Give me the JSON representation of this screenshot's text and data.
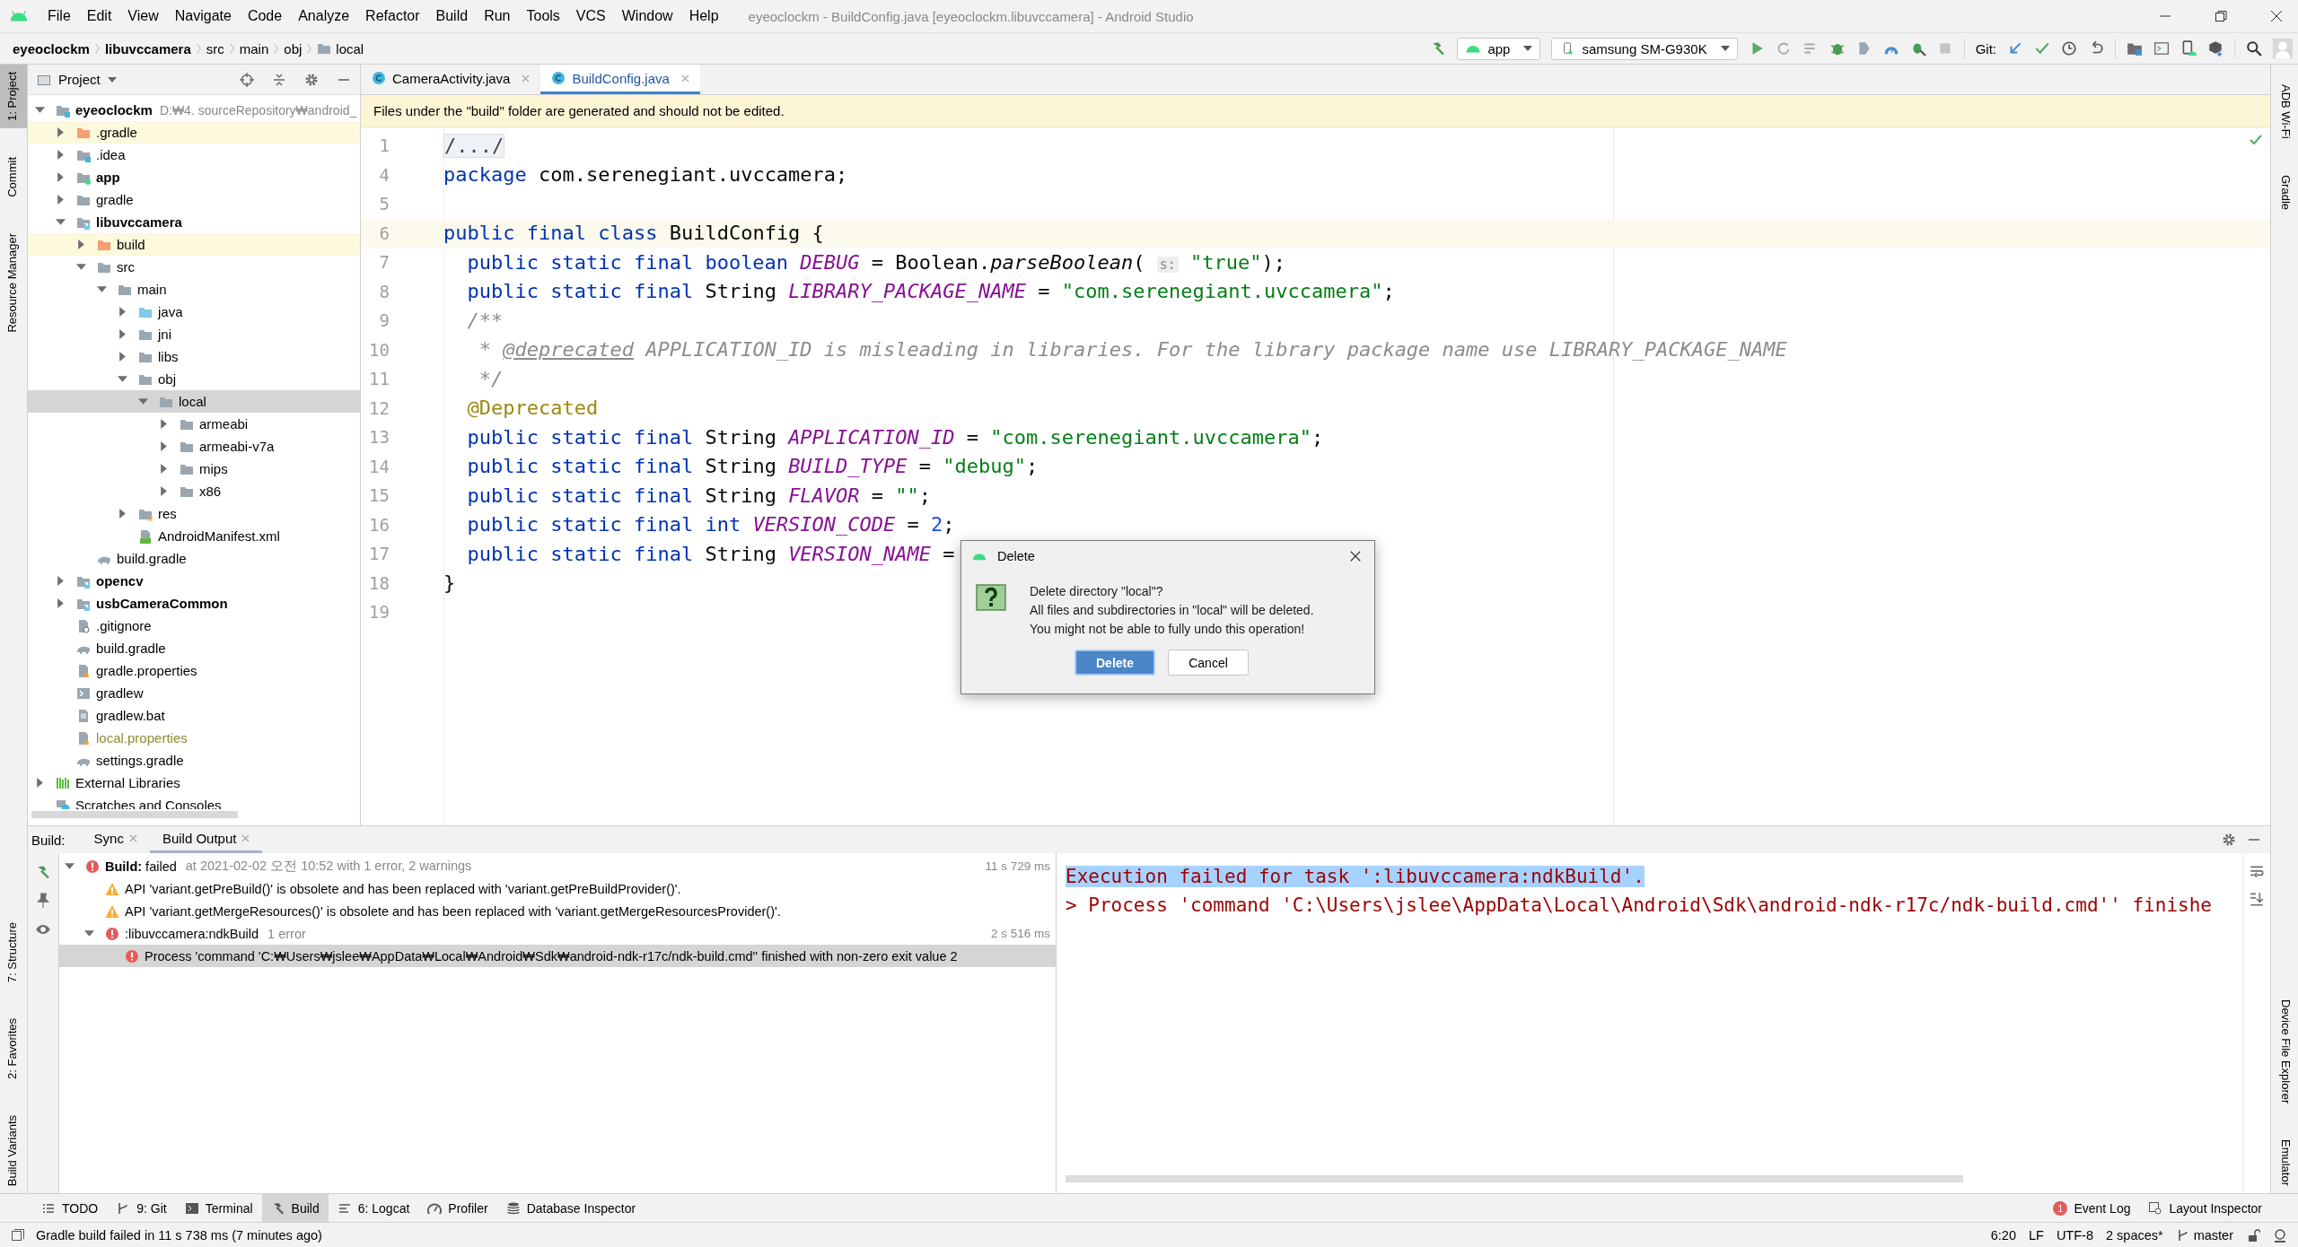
{
  "window": {
    "title": "eyeoclockm - BuildConfig.java [eyeoclockm.libuvccamera] - Android Studio"
  },
  "menu": [
    "File",
    "Edit",
    "View",
    "Navigate",
    "Code",
    "Analyze",
    "Refactor",
    "Build",
    "Run",
    "Tools",
    "VCS",
    "Window",
    "Help"
  ],
  "breadcrumbs": [
    {
      "label": "eyeoclockm",
      "bold": true
    },
    {
      "label": "libuvccamera",
      "bold": true
    },
    {
      "label": "src",
      "bold": false
    },
    {
      "label": "main",
      "bold": false
    },
    {
      "label": "obj",
      "bold": false
    },
    {
      "label": "local",
      "bold": false
    }
  ],
  "toolbar": {
    "run_config": "app",
    "device": "samsung SM-G930K",
    "git_label": "Git:"
  },
  "left_stripe": [
    {
      "label": "1: Project",
      "selected": true
    },
    {
      "label": "Commit",
      "selected": false
    },
    {
      "label": "Resource Manager",
      "selected": false
    }
  ],
  "left_stripe_bottom": [
    "7: Structure",
    "2: Favorites",
    "Build Variants"
  ],
  "right_stripe": [
    "ADB Wi-Fi",
    "Gradle"
  ],
  "right_stripe_bottom": [
    "Device File Explorer",
    "Emulator"
  ],
  "project": {
    "view": "Project",
    "tree": [
      {
        "label": "eyeoclockm",
        "hint": "D:₩4. sourceRepository₩android_",
        "kind": "module",
        "bold": true,
        "selected": false,
        "expanded": true,
        "children": [
          {
            "label": ".gradle",
            "kind": "folder-excluded",
            "excluded": true,
            "selected": false,
            "expanded": false
          },
          {
            "label": ".idea",
            "kind": "folder-config",
            "selected": false,
            "expanded": false
          },
          {
            "label": "app",
            "kind": "module-app",
            "bold": true,
            "selected": false,
            "expanded": false
          },
          {
            "label": "gradle",
            "kind": "folder",
            "selected": false,
            "expanded": false
          },
          {
            "label": "libuvccamera",
            "kind": "module-lib",
            "bold": true,
            "selected": false,
            "expanded": true,
            "children": [
              {
                "label": "build",
                "kind": "folder-excluded",
                "excluded": true,
                "selected": false,
                "expanded": false
              },
              {
                "label": "src",
                "kind": "folder",
                "selected": false,
                "expanded": true,
                "children": [
                  {
                    "label": "main",
                    "kind": "folder",
                    "selected": false,
                    "expanded": true,
                    "children": [
                      {
                        "label": "java",
                        "kind": "folder-source",
                        "selected": false,
                        "expanded": false
                      },
                      {
                        "label": "jni",
                        "kind": "folder",
                        "selected": false,
                        "expanded": false
                      },
                      {
                        "label": "libs",
                        "kind": "folder",
                        "selected": false,
                        "expanded": false
                      },
                      {
                        "label": "obj",
                        "kind": "folder",
                        "selected": false,
                        "expanded": true,
                        "children": [
                          {
                            "label": "local",
                            "kind": "folder",
                            "selected": true,
                            "expanded": true,
                            "children": [
                              {
                                "label": "armeabi",
                                "kind": "folder",
                                "selected": false,
                                "expanded": false
                              },
                              {
                                "label": "armeabi-v7a",
                                "kind": "folder",
                                "selected": false,
                                "expanded": false
                              },
                              {
                                "label": "mips",
                                "kind": "folder",
                                "selected": false,
                                "expanded": false
                              },
                              {
                                "label": "x86",
                                "kind": "folder",
                                "selected": false,
                                "expanded": false
                              }
                            ]
                          }
                        ]
                      },
                      {
                        "label": "res",
                        "kind": "folder-res",
                        "selected": false,
                        "expanded": false
                      },
                      {
                        "label": "AndroidManifest.xml",
                        "kind": "manifest",
                        "selected": false
                      }
                    ]
                  }
                ]
              },
              {
                "label": "build.gradle",
                "kind": "gradle",
                "selected": false
              }
            ]
          },
          {
            "label": "opencv",
            "kind": "module-lib",
            "bold": true,
            "selected": false,
            "expanded": false
          },
          {
            "label": "usbCameraCommon",
            "kind": "module-lib",
            "bold": true,
            "selected": false,
            "expanded": false
          },
          {
            "label": ".gitignore",
            "kind": "gitignore",
            "selected": false
          },
          {
            "label": "build.gradle",
            "kind": "gradle",
            "selected": false
          },
          {
            "label": "gradle.properties",
            "kind": "properties",
            "selected": false
          },
          {
            "label": "gradlew",
            "kind": "gradlew",
            "selected": false
          },
          {
            "label": "gradlew.bat",
            "kind": "bat",
            "selected": false
          },
          {
            "label": "local.properties",
            "kind": "properties",
            "ignored": true,
            "selected": false
          },
          {
            "label": "settings.gradle",
            "kind": "gradle",
            "selected": false
          }
        ]
      },
      {
        "label": "External Libraries",
        "kind": "libraries",
        "selected": false,
        "expanded": false
      },
      {
        "label": "Scratches and Consoles",
        "kind": "scratches",
        "selected": false
      }
    ]
  },
  "editor": {
    "tabs": [
      {
        "label": "CameraActivity.java",
        "selected": false
      },
      {
        "label": "BuildConfig.java",
        "selected": true
      }
    ],
    "banner": "Files under the \"build\" folder are generated and should not be edited.",
    "lines": [
      {
        "number": "1",
        "current": false,
        "tokens": [
          {
            "kind": "fold",
            "text": "/.../"
          }
        ]
      },
      {
        "number": "4",
        "current": false,
        "tokens": [
          {
            "kind": "kw",
            "text": "package "
          },
          {
            "kind": "plain",
            "text": "com.serenegiant.uvccamera;"
          }
        ]
      },
      {
        "number": "5",
        "current": false
      },
      {
        "number": "6",
        "current": true,
        "tokens": [
          {
            "kind": "kw",
            "text": "public final class "
          },
          {
            "kind": "plain",
            "text": "BuildConfig {"
          }
        ]
      },
      {
        "number": "7",
        "current": false,
        "tokens": [
          {
            "kind": "kw",
            "text": "  public static final boolean "
          },
          {
            "kind": "field",
            "text": "DEBUG"
          },
          {
            "kind": "plain",
            "text": " = Boolean."
          },
          {
            "kind": "method",
            "text": "parseBoolean"
          },
          {
            "kind": "plain",
            "text": "( "
          },
          {
            "kind": "hint",
            "text": "s:"
          },
          {
            "kind": "string",
            "text": " \"true\""
          },
          {
            "kind": "plain",
            "text": ");"
          }
        ]
      },
      {
        "number": "8",
        "current": false,
        "tokens": [
          {
            "kind": "kw",
            "text": "  public static final "
          },
          {
            "kind": "plain",
            "text": "String "
          },
          {
            "kind": "field",
            "text": "LIBRARY_PACKAGE_NAME"
          },
          {
            "kind": "plain",
            "text": " = "
          },
          {
            "kind": "string",
            "text": "\"com.serenegiant.uvccamera\""
          },
          {
            "kind": "plain",
            "text": ";"
          }
        ]
      },
      {
        "number": "9",
        "current": false,
        "tokens": [
          {
            "kind": "comment",
            "text": "  /**"
          }
        ]
      },
      {
        "number": "10",
        "current": false,
        "tokens": [
          {
            "kind": "comment",
            "text": "   * "
          },
          {
            "kind": "doctag",
            "text": "@deprecated"
          },
          {
            "kind": "comment",
            "text": " APPLICATION_ID is misleading in libraries. For the library package name use LIBRARY_PACKAGE_NAME"
          }
        ]
      },
      {
        "number": "11",
        "current": false,
        "tokens": [
          {
            "kind": "comment",
            "text": "   */"
          }
        ]
      },
      {
        "number": "12",
        "current": false,
        "tokens": [
          {
            "kind": "annotation",
            "text": "  @Deprecated"
          }
        ]
      },
      {
        "number": "13",
        "current": false,
        "tokens": [
          {
            "kind": "kw",
            "text": "  public static final "
          },
          {
            "kind": "plain",
            "text": "String "
          },
          {
            "kind": "field",
            "text": "APPLICATION_ID"
          },
          {
            "kind": "plain",
            "text": " = "
          },
          {
            "kind": "string",
            "text": "\"com.serenegiant.uvccamera\""
          },
          {
            "kind": "plain",
            "text": ";"
          }
        ]
      },
      {
        "number": "14",
        "current": false,
        "tokens": [
          {
            "kind": "kw",
            "text": "  public static final "
          },
          {
            "kind": "plain",
            "text": "String "
          },
          {
            "kind": "field",
            "text": "BUILD_TYPE"
          },
          {
            "kind": "plain",
            "text": " = "
          },
          {
            "kind": "string",
            "text": "\"debug\""
          },
          {
            "kind": "plain",
            "text": ";"
          }
        ]
      },
      {
        "number": "15",
        "current": false,
        "tokens": [
          {
            "kind": "kw",
            "text": "  public static final "
          },
          {
            "kind": "plain",
            "text": "String "
          },
          {
            "kind": "field",
            "text": "FLAVOR"
          },
          {
            "kind": "plain",
            "text": " = "
          },
          {
            "kind": "string",
            "text": "\"\""
          },
          {
            "kind": "plain",
            "text": ";"
          }
        ]
      },
      {
        "number": "16",
        "current": false,
        "tokens": [
          {
            "kind": "kw",
            "text": "  public static final int "
          },
          {
            "kind": "field",
            "text": "VERSION_CODE"
          },
          {
            "kind": "plain",
            "text": " = "
          },
          {
            "kind": "number",
            "text": "2"
          },
          {
            "kind": "plain",
            "text": ";"
          }
        ]
      },
      {
        "number": "17",
        "current": false,
        "tokens": [
          {
            "kind": "kw",
            "text": "  public static final "
          },
          {
            "kind": "plain",
            "text": "String "
          },
          {
            "kind": "field",
            "text": "VERSION_NAME"
          },
          {
            "kind": "plain",
            "text": " ="
          }
        ]
      },
      {
        "number": "18",
        "current": false,
        "tokens": [
          {
            "kind": "plain",
            "text": "}"
          }
        ]
      },
      {
        "number": "19",
        "current": false
      }
    ]
  },
  "dialog": {
    "title": "Delete",
    "message": "Delete directory \"local\"?\nAll files and subdirectories in \"local\" will be deleted.\nYou might not be able to fully undo this operation!",
    "buttons": [
      {
        "label": "Delete",
        "kind": "primary"
      },
      {
        "label": "Cancel",
        "kind": "secondary"
      }
    ]
  },
  "build": {
    "label": "Build:",
    "tabs": [
      {
        "label": "Sync",
        "selected": false
      },
      {
        "label": "Build Output",
        "selected": true
      }
    ],
    "tree": [
      {
        "kind": "error",
        "text": "**Build:** failed",
        "hint": "at 2021-02-02 오전 10:52 with 1 error, 2 warnings",
        "time": "11 s 729 ms",
        "selected": false,
        "expanded": true,
        "children": [
          {
            "kind": "warning",
            "text": "API 'variant.getPreBuild()' is obsolete and has been replaced with 'variant.getPreBuildProvider()'.",
            "selected": false
          },
          {
            "kind": "warning",
            "text": "API 'variant.getMergeResources()' is obsolete and has been replaced with 'variant.getMergeResourcesProvider()'.",
            "selected": false
          },
          {
            "kind": "error",
            "text": ":libuvccamera:ndkBuild",
            "hint": "1 error",
            "time": "2 s 516 ms",
            "selected": false,
            "expanded": true,
            "children": [
              {
                "kind": "error",
                "text": "Process 'command 'C:₩Users₩jslee₩AppData₩Local₩Android₩Sdk₩android-ndk-r17c/ndk-build.cmd'' finished with non-zero exit value 2",
                "selected": true
              }
            ]
          }
        ]
      }
    ],
    "console": [
      {
        "text": "Execution failed for task ':libuvccamera:ndkBuild'.",
        "selected": true
      },
      {
        "text": "> Process 'command 'C:\\Users\\jslee\\AppData\\Local\\Android\\Sdk\\android-ndk-r17c/ndk-build.cmd'' finishe",
        "selected": false
      }
    ]
  },
  "tool_tabs": [
    {
      "label": "TODO",
      "kind": "list",
      "selected": false
    },
    {
      "label": "9: Git",
      "kind": "git",
      "selected": false
    },
    {
      "label": "Terminal",
      "kind": "terminal",
      "selected": false
    },
    {
      "label": "Build",
      "kind": "hammer",
      "selected": true
    },
    {
      "label": "6: Logcat",
      "kind": "logcat",
      "selected": false
    },
    {
      "label": "Profiler",
      "kind": "gauge",
      "selected": false
    },
    {
      "label": "Database Inspector",
      "kind": "database",
      "selected": false
    }
  ],
  "tool_tabs_right": [
    {
      "label": "Event Log",
      "badge": "1"
    },
    {
      "label": "Layout Inspector"
    }
  ],
  "status": {
    "message": "Gradle build failed in 11 s 738 ms (7 minutes ago)",
    "items": [
      "6:20",
      "LF",
      "UTF-8",
      "2 spaces*"
    ],
    "branch": "master"
  }
}
